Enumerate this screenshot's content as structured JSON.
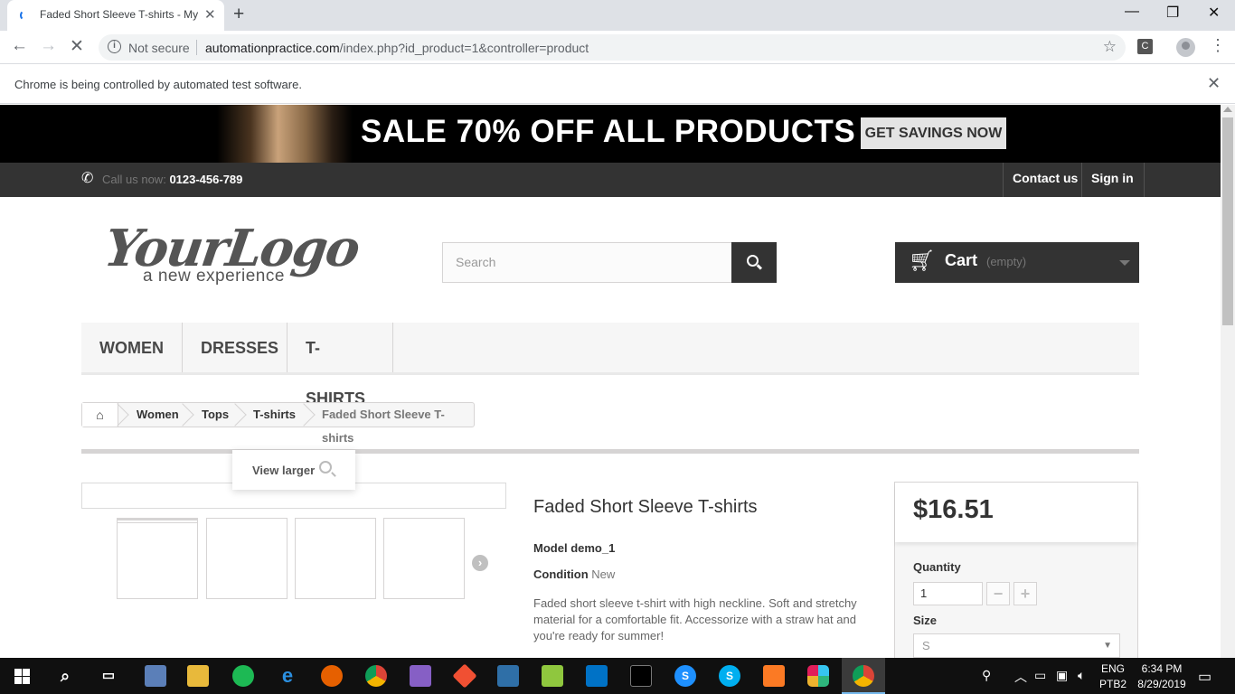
{
  "browser": {
    "tab_title": "Faded Short Sleeve T-shirts - My",
    "security_label": "Not secure",
    "url_host": "automationpractice.com",
    "url_path": "/index.php?id_product=1&controller=product",
    "extension_label": "C",
    "infobar_text": "Chrome is being controlled by automated test software."
  },
  "site": {
    "banner_text": "SALE 70% OFF ALL PRODUCTS",
    "banner_button": "GET SAVINGS NOW",
    "callus_label": "Call us now:",
    "callus_number": "0123-456-789",
    "contact_link": "Contact us",
    "signin_link": "Sign in",
    "logo_main": "YourLogo",
    "logo_sub": "a new experience",
    "search_placeholder": "Search",
    "cart_label": "Cart",
    "cart_status": "(empty)",
    "menu": [
      "WOMEN",
      "DRESSES",
      "T-SHIRTS"
    ],
    "breadcrumb": [
      "Women",
      "Tops",
      "T-shirts",
      "Faded Short Sleeve T-shirts"
    ]
  },
  "product": {
    "view_larger": "View larger",
    "name": "Faded Short Sleeve T-shirts",
    "model_label": "Model",
    "model_value": "demo_1",
    "condition_label": "Condition",
    "condition_value": "New",
    "description": "Faded short sleeve t-shirt with high neckline. Soft and stretchy material for a comfortable fit. Accessorize with a straw hat and you're ready for summer!",
    "price": "$16.51",
    "quantity_label": "Quantity",
    "quantity_value": "1",
    "size_label": "Size",
    "size_value": "S"
  },
  "taskbar": {
    "language": "ENG",
    "layout": "PTB2",
    "time": "6:34 PM",
    "date": "8/29/2019",
    "icons": [
      "search-icon",
      "task-view-icon",
      "paint-icon",
      "file-explorer-icon",
      "spotify-icon",
      "edge-icon",
      "firefox-icon",
      "chrome-icon",
      "visual-studio-icon",
      "git-icon",
      "virtualbox-icon",
      "notepad-plus-icon",
      "outlook-icon",
      "terminal-icon",
      "skype-s-icon",
      "skype-icon",
      "xampp-icon",
      "slack-icon",
      "chrome-active-icon"
    ]
  },
  "colors": {
    "header_dark": "#333333",
    "banner_bg": "#000000",
    "chrome_accent": "#1a73e8"
  }
}
